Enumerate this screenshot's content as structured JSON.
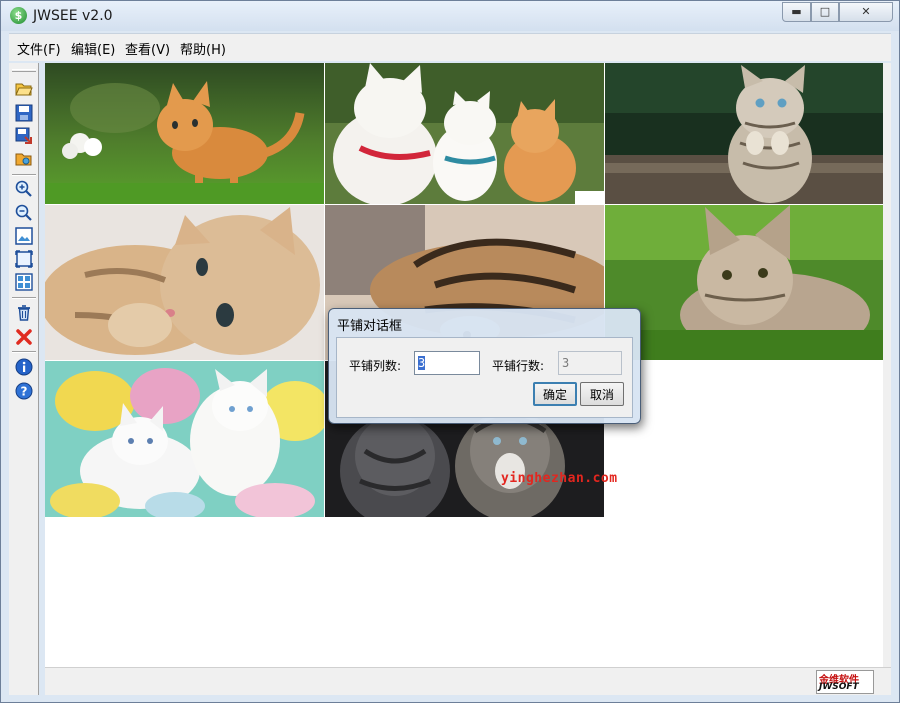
{
  "window": {
    "title": "JWSEE v2.0",
    "icon": "app-logo-icon",
    "controls": [
      "minimize-icon",
      "maximize-icon",
      "close-icon"
    ]
  },
  "menu": {
    "items": [
      {
        "label": "文件(F)"
      },
      {
        "label": "编辑(E)"
      },
      {
        "label": "查看(V)"
      },
      {
        "label": "帮助(H)"
      }
    ]
  },
  "toolbar": {
    "buttons": [
      "open-folder-icon",
      "save-icon",
      "save-as-icon",
      "browse-folder-icon",
      "zoom-in-icon",
      "zoom-out-icon",
      "fit-window-icon",
      "actual-size-icon",
      "tile-icon",
      "delete-icon",
      "close-icon",
      "info-icon",
      "help-icon"
    ]
  },
  "tiles": [
    {
      "name": "tile-1",
      "subject": "orange-kitten-on-grass"
    },
    {
      "name": "tile-2",
      "subject": "three-cats-sitting"
    },
    {
      "name": "tile-3",
      "subject": "tabby-kitten-paws-up"
    },
    {
      "name": "tile-4",
      "subject": "kitten-lying-close-up"
    },
    {
      "name": "tile-5",
      "subject": "tabby-cat-lying"
    },
    {
      "name": "tile-6",
      "subject": "kitten-in-grass"
    },
    {
      "name": "tile-7",
      "subject": "white-kittens-candy"
    },
    {
      "name": "tile-8",
      "subject": "long-haired-kittens"
    }
  ],
  "watermark": "yinghezhan.com",
  "logo": {
    "top": "金维软件",
    "bottom": "JWSOFT"
  },
  "dialog": {
    "title": "平铺对话框",
    "columns_label": "平铺列数:",
    "columns_value": "3",
    "rows_label": "平铺行数:",
    "rows_value": "3",
    "ok_label": "确定",
    "cancel_label": "取消"
  },
  "colors": {
    "frame": "#dce7f3",
    "menubar": "#f0f0f0",
    "watermark": "#e3261f",
    "dialog_focus": "#3c7fb1"
  }
}
